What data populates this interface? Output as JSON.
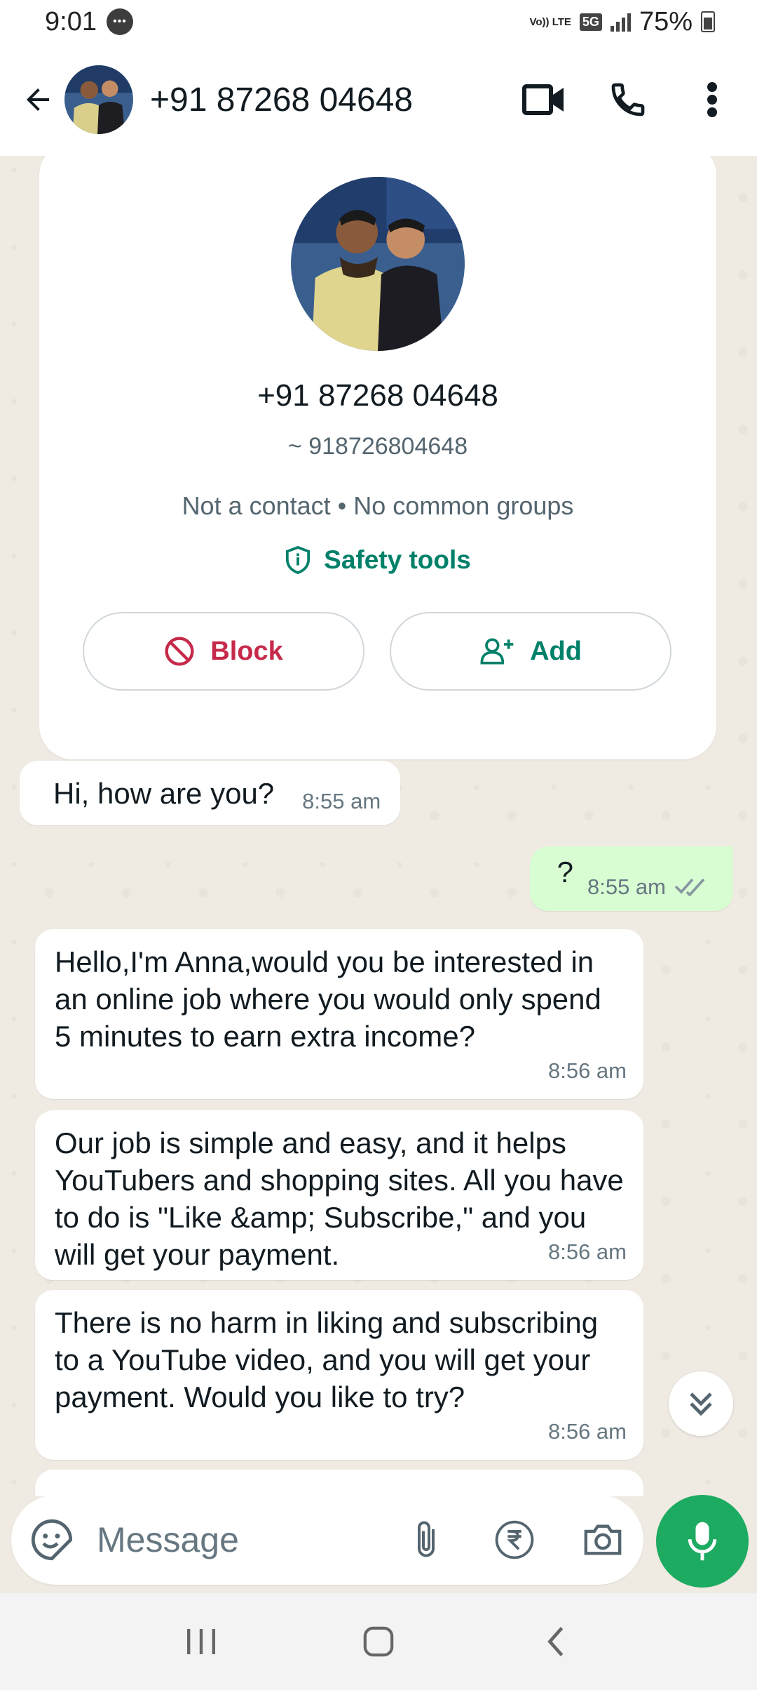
{
  "status_bar": {
    "time": "9:01",
    "network_lte": "Vo)) LTE",
    "network_5g": "5G",
    "battery": "75%",
    "icons": [
      "message-notification-icon",
      "signal-icon",
      "battery-icon"
    ]
  },
  "header": {
    "title": "+91 87268 04648",
    "icons": [
      "back-arrow-icon",
      "video-call-icon",
      "voice-call-icon",
      "more-options-icon"
    ]
  },
  "contact_card": {
    "phone": "+91 87268 04648",
    "alt_name": "~ 918726804648",
    "subtitle": "Not a contact • No common groups",
    "safety_tools": "Safety tools",
    "block_label": "Block",
    "add_label": "Add"
  },
  "messages": [
    {
      "direction": "in",
      "text": "Hi, how are you?",
      "time": "8:55 am"
    },
    {
      "direction": "out",
      "text": "?",
      "time": "8:55 am",
      "status": "read"
    },
    {
      "direction": "in",
      "text": "Hello,I'm Anna,would you be interested in an online job where you would only spend 5 minutes to earn extra income?",
      "time": "8:56 am"
    },
    {
      "direction": "in",
      "text": "Our job is simple and easy, and it helps YouTubers and shopping sites. All you have to do is \"Like &amp; Subscribe,\" and you will get your payment.",
      "time": "8:56 am"
    },
    {
      "direction": "in",
      "text": "There is no harm in liking and subscribing to a YouTube video, and you will get your payment. Would you like to try?",
      "time": "8:56 am"
    }
  ],
  "composer": {
    "placeholder": "Message",
    "icons": [
      "emoji-sticker-icon",
      "attachment-icon",
      "rupee-payment-icon",
      "camera-icon",
      "mic-icon"
    ]
  },
  "nav_bar": {
    "icons": [
      "recent-apps-icon",
      "home-icon",
      "back-nav-icon"
    ]
  },
  "colors": {
    "accent_green": "#008069",
    "mic_green": "#1daa61",
    "block_red": "#c62a4a",
    "outgoing_bubble": "#d9fdd3",
    "chat_bg": "#efeae2"
  }
}
